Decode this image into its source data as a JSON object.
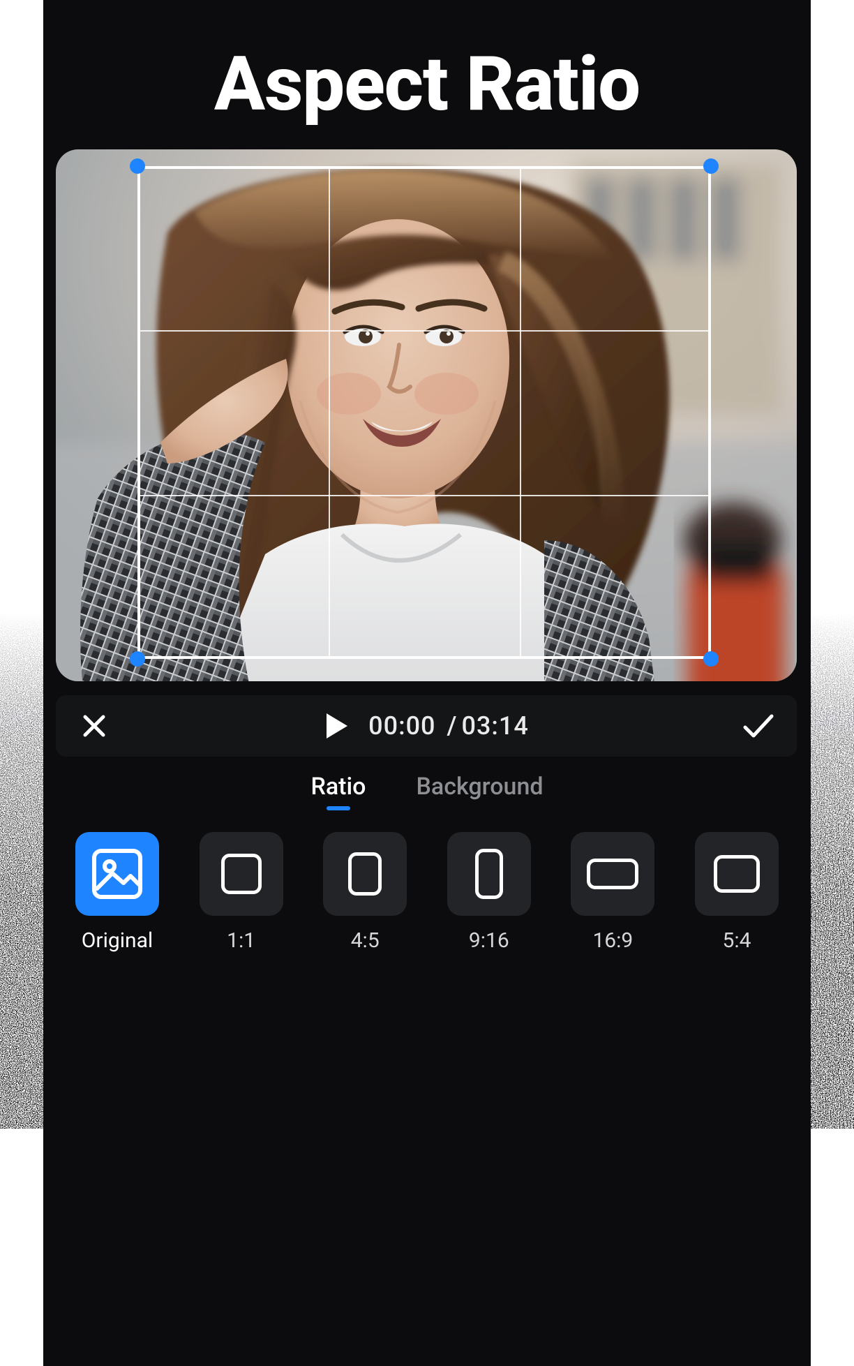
{
  "title": "Aspect Ratio",
  "player": {
    "current_time": "00:00",
    "separator": "/",
    "duration": "03:14"
  },
  "tabs": {
    "ratio": "Ratio",
    "background": "Background",
    "active": "ratio"
  },
  "ratio_options": [
    {
      "key": "original",
      "label": "Original",
      "active": true
    },
    {
      "key": "1-1",
      "label": "1:1"
    },
    {
      "key": "4-5",
      "label": "4:5"
    },
    {
      "key": "9-16",
      "label": "9:16"
    },
    {
      "key": "16-9",
      "label": "16:9"
    },
    {
      "key": "5-4",
      "label": "5:4"
    }
  ],
  "icons": {
    "close": "close-icon",
    "play": "play-icon",
    "confirm": "check-icon",
    "image": "image-icon"
  },
  "colors": {
    "accent": "#1e84ff",
    "panel": "#0c0c0e",
    "swatch": "#232427",
    "text_muted": "#8d8f93"
  }
}
